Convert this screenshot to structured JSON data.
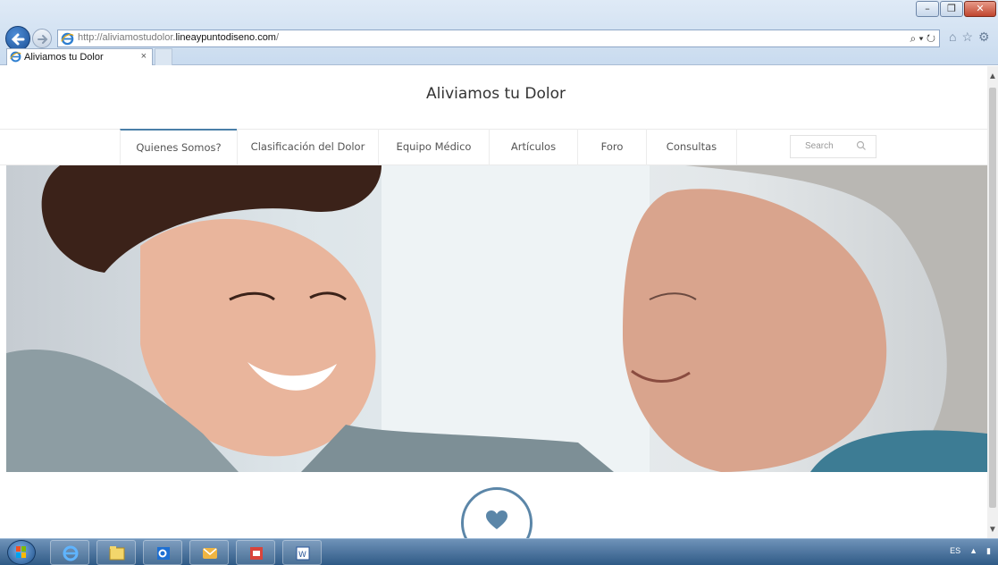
{
  "browser": {
    "url_prefix": "http://aliviamostudolor.",
    "url_domain": "lineaypuntodiseno.com",
    "url_suffix": "/",
    "address_tools": "⌕ ▾ ↻",
    "tab_title": "Aliviamos tu Dolor",
    "tab_close": "×",
    "window_buttons": [
      "–",
      "❐",
      "✕"
    ],
    "toolbar_icons": [
      "home-icon",
      "favorites-star-icon",
      "settings-gear-icon"
    ]
  },
  "site": {
    "title": "Aliviamos tu Dolor",
    "menu": [
      {
        "label": "Quienes Somos?",
        "active": true
      },
      {
        "label": "Clasificación del Dolor",
        "active": false
      },
      {
        "label": "Equipo Médico",
        "active": false
      },
      {
        "label": "Artículos",
        "active": false
      },
      {
        "label": "Foro",
        "active": false
      },
      {
        "label": "Consultas",
        "active": false
      }
    ],
    "search_placeholder": "Search",
    "hero_image": "caregiver-and-elderly-woman-photo",
    "feature_icon": "heart-icon",
    "accent_color": "#4a7fa8"
  },
  "taskbar": {
    "apps": [
      "internet-explorer-icon",
      "file-explorer-icon",
      "outlook-icon",
      "messenger-icon",
      "pdf-reader-icon",
      "word-icon"
    ],
    "language": "ES"
  }
}
